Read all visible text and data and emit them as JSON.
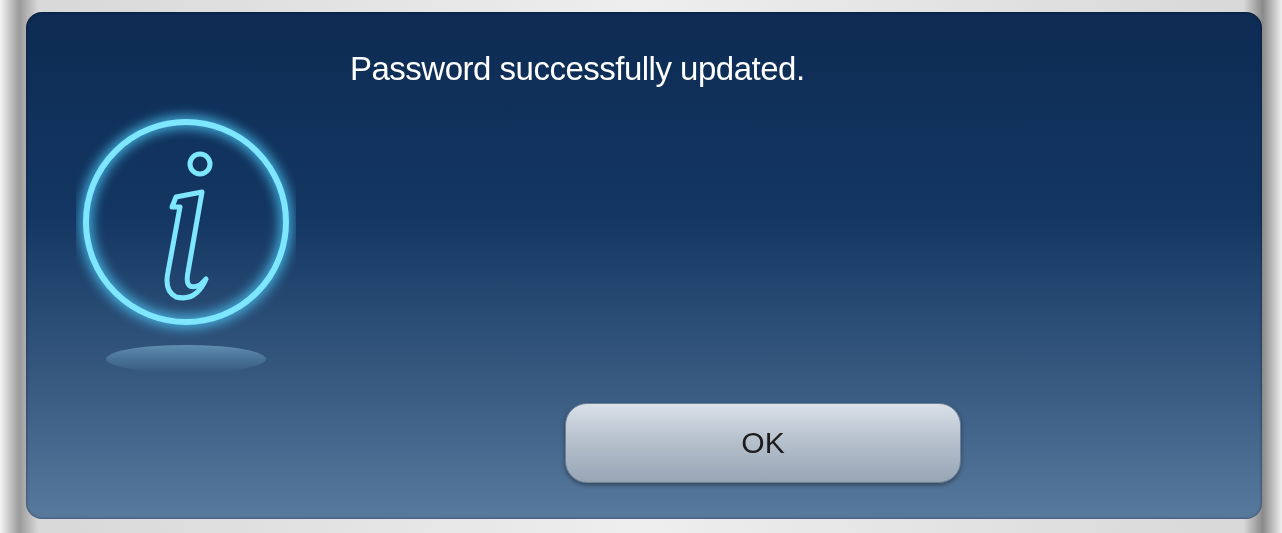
{
  "dialog": {
    "message": "Password successfully updated.",
    "buttons": [
      {
        "label": "OK"
      }
    ]
  }
}
